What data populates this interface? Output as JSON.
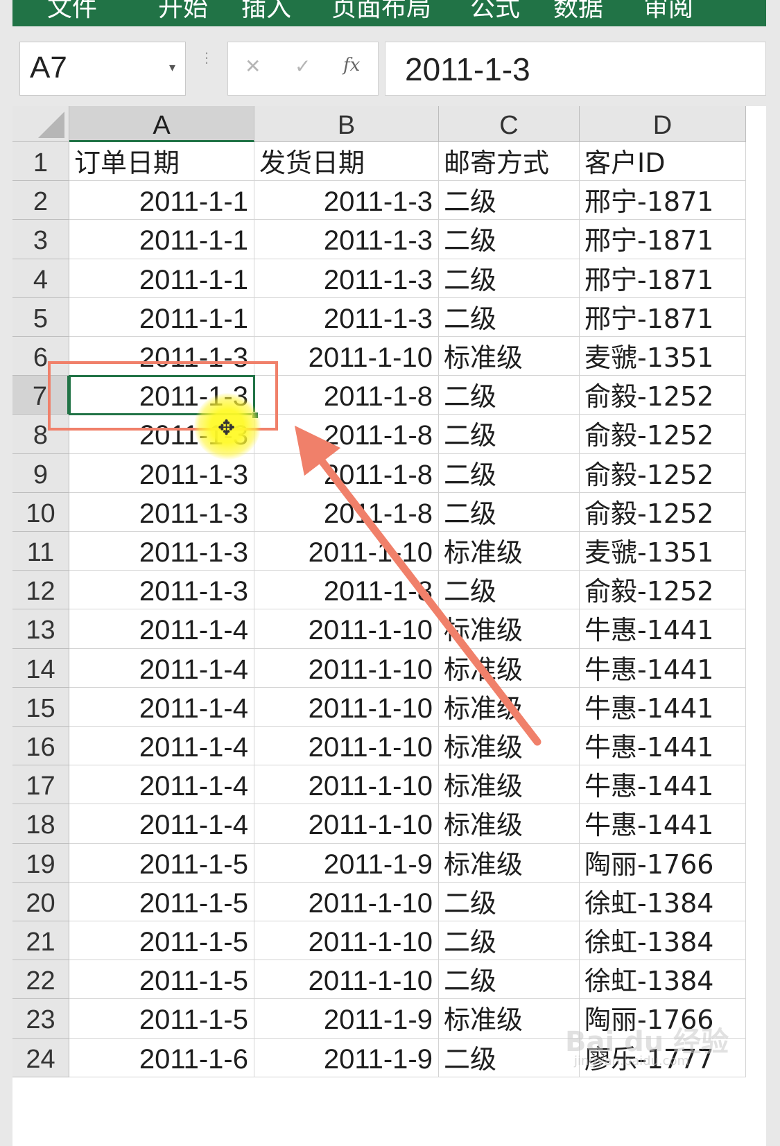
{
  "ribbon": {
    "tabs": [
      "文件",
      "开始",
      "插入",
      "页面布局",
      "公式",
      "数据",
      "审阅"
    ],
    "color": "#217346"
  },
  "formula_bar": {
    "name_box": "A7",
    "cancel_icon": "close-icon",
    "enter_icon": "check-icon",
    "fx_label": "fx",
    "value": "2011-1-3"
  },
  "sheet": {
    "columns": [
      "A",
      "B",
      "C",
      "D"
    ],
    "active_cell": "A7",
    "rows": [
      {
        "n": "1",
        "cells": [
          "订单日期",
          "发货日期",
          "邮寄方式",
          "客户ID"
        ]
      },
      {
        "n": "2",
        "cells": [
          "2011-1-1",
          "2011-1-3",
          "二级",
          "邢宁-1871"
        ]
      },
      {
        "n": "3",
        "cells": [
          "2011-1-1",
          "2011-1-3",
          "二级",
          "邢宁-1871"
        ]
      },
      {
        "n": "4",
        "cells": [
          "2011-1-1",
          "2011-1-3",
          "二级",
          "邢宁-1871"
        ]
      },
      {
        "n": "5",
        "cells": [
          "2011-1-1",
          "2011-1-3",
          "二级",
          "邢宁-1871"
        ]
      },
      {
        "n": "6",
        "cells": [
          "2011-1-3",
          "2011-1-10",
          "标准级",
          "麦虢-1351"
        ]
      },
      {
        "n": "7",
        "cells": [
          "2011-1-3",
          "2011-1-8",
          "二级",
          "俞毅-1252"
        ]
      },
      {
        "n": "8",
        "cells": [
          "2011-1-3",
          "2011-1-8",
          "二级",
          "俞毅-1252"
        ]
      },
      {
        "n": "9",
        "cells": [
          "2011-1-3",
          "2011-1-8",
          "二级",
          "俞毅-1252"
        ]
      },
      {
        "n": "10",
        "cells": [
          "2011-1-3",
          "2011-1-8",
          "二级",
          "俞毅-1252"
        ]
      },
      {
        "n": "11",
        "cells": [
          "2011-1-3",
          "2011-1-10",
          "标准级",
          "麦虢-1351"
        ]
      },
      {
        "n": "12",
        "cells": [
          "2011-1-3",
          "2011-1-8",
          "二级",
          "俞毅-1252"
        ]
      },
      {
        "n": "13",
        "cells": [
          "2011-1-4",
          "2011-1-10",
          "标准级",
          "牛惠-1441"
        ]
      },
      {
        "n": "14",
        "cells": [
          "2011-1-4",
          "2011-1-10",
          "标准级",
          "牛惠-1441"
        ]
      },
      {
        "n": "15",
        "cells": [
          "2011-1-4",
          "2011-1-10",
          "标准级",
          "牛惠-1441"
        ]
      },
      {
        "n": "16",
        "cells": [
          "2011-1-4",
          "2011-1-10",
          "标准级",
          "牛惠-1441"
        ]
      },
      {
        "n": "17",
        "cells": [
          "2011-1-4",
          "2011-1-10",
          "标准级",
          "牛惠-1441"
        ]
      },
      {
        "n": "18",
        "cells": [
          "2011-1-4",
          "2011-1-10",
          "标准级",
          "牛惠-1441"
        ]
      },
      {
        "n": "19",
        "cells": [
          "2011-1-5",
          "2011-1-9",
          "标准级",
          "陶丽-1766"
        ]
      },
      {
        "n": "20",
        "cells": [
          "2011-1-5",
          "2011-1-10",
          "二级",
          "徐虹-1384"
        ]
      },
      {
        "n": "21",
        "cells": [
          "2011-1-5",
          "2011-1-10",
          "二级",
          "徐虹-1384"
        ]
      },
      {
        "n": "22",
        "cells": [
          "2011-1-5",
          "2011-1-10",
          "二级",
          "徐虹-1384"
        ]
      },
      {
        "n": "23",
        "cells": [
          "2011-1-5",
          "2011-1-9",
          "标准级",
          "陶丽-1766"
        ]
      },
      {
        "n": "24",
        "cells": [
          "2011-1-6",
          "2011-1-9",
          "二级",
          "廖乐-1777"
        ]
      }
    ]
  },
  "annotation": {
    "highlight_color": "#f0806a",
    "arrow_color": "#f0806a",
    "cursor_highlight_color": "#fff428"
  },
  "watermark": {
    "logo": "Bai du 经验",
    "url": "jingyan.baidu.com"
  }
}
